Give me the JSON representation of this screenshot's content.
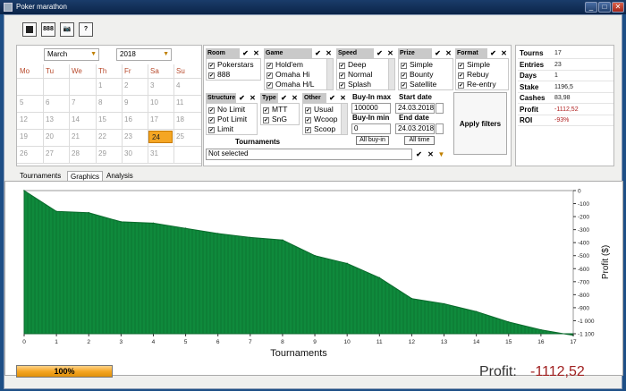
{
  "window": {
    "title": "Poker marathon"
  },
  "toolbar": {
    "buttons": [
      {
        "name": "open-button",
        "label": ""
      },
      {
        "name": "888-button",
        "label": "888"
      },
      {
        "name": "screenshot-button",
        "label": "📷"
      },
      {
        "name": "help-button",
        "label": "?"
      }
    ]
  },
  "calendar": {
    "month": "March",
    "year": "2018",
    "weekdays": [
      "Mo",
      "Tu",
      "We",
      "Th",
      "Fr",
      "Sa",
      "Su"
    ],
    "weeks": [
      [
        "",
        "",
        "",
        "1",
        "2",
        "3",
        "4"
      ],
      [
        "5",
        "6",
        "7",
        "8",
        "9",
        "10",
        "11"
      ],
      [
        "12",
        "13",
        "14",
        "15",
        "16",
        "17",
        "18"
      ],
      [
        "19",
        "20",
        "21",
        "22",
        "23",
        "24",
        "25"
      ],
      [
        "26",
        "27",
        "28",
        "29",
        "30",
        "31",
        ""
      ]
    ],
    "selected": "24"
  },
  "filters": {
    "room": {
      "title": "Room",
      "items": [
        "Pokerstars",
        "888"
      ]
    },
    "game": {
      "title": "Game",
      "items": [
        "Hold'em",
        "Omaha Hi",
        "Omaha H/L"
      ]
    },
    "speed": {
      "title": "Speed",
      "items": [
        "Deep",
        "Normal",
        "Splash"
      ]
    },
    "prize": {
      "title": "Prize",
      "items": [
        "Simple",
        "Bounty",
        "Satellite"
      ]
    },
    "format": {
      "title": "Format",
      "items": [
        "Simple",
        "Rebuy",
        "Re-entry"
      ]
    },
    "structure": {
      "title": "Structure",
      "items": [
        "No Limit",
        "Pot Limit",
        "Limit"
      ]
    },
    "type": {
      "title": "Type",
      "items": [
        "MTT",
        "SnG"
      ]
    },
    "other": {
      "title": "Other",
      "items": [
        "Usual",
        "Wcoop",
        "Scoop"
      ]
    },
    "buyin_max_label": "Buy-In max",
    "buyin_max": "100000",
    "buyin_min_label": "Buy-In min",
    "buyin_min": "0",
    "all_buyin": "All buy-in",
    "start_date_label": "Start date",
    "start_date": "24.03.2018",
    "end_date_label": "End date",
    "end_date": "24.03.2018",
    "all_time": "All time",
    "apply": "Apply filters",
    "tournaments_label": "Tournaments",
    "tournaments_value": "Not selected"
  },
  "stats": [
    {
      "k": "Tourns",
      "v": "17",
      "color": "#222222"
    },
    {
      "k": "Entries",
      "v": "23",
      "color": "#222222"
    },
    {
      "k": "Days",
      "v": "1",
      "color": "#222222"
    },
    {
      "k": "Stake",
      "v": "1196,5",
      "color": "#222222"
    },
    {
      "k": "Cashes",
      "v": "83,98",
      "color": "#222222"
    },
    {
      "k": "Profit",
      "v": "-1112,52",
      "color": "#b02020"
    },
    {
      "k": "ROI",
      "v": "-93%",
      "color": "#b02020"
    }
  ],
  "tabs": [
    "Tournaments",
    "Graphics",
    "Analysis"
  ],
  "active_tab": "Graphics",
  "chart_data": {
    "type": "area",
    "xlabel": "Tournaments",
    "ylabel": "Profit ($)",
    "x": [
      0,
      1,
      2,
      3,
      4,
      5,
      6,
      7,
      8,
      9,
      10,
      11,
      12,
      13,
      14,
      15,
      16,
      17
    ],
    "values": [
      0,
      -160,
      -170,
      -240,
      -250,
      -290,
      -330,
      -360,
      -380,
      -500,
      -560,
      -670,
      -830,
      -870,
      -930,
      -1010,
      -1070,
      -1112.52
    ],
    "xlim": [
      0,
      17
    ],
    "ylim": [
      -1100,
      0
    ],
    "xticks": [
      "0",
      "1",
      "2",
      "3",
      "4",
      "5",
      "6",
      "7",
      "8",
      "9",
      "10",
      "11",
      "12",
      "13",
      "14",
      "15",
      "16",
      "17"
    ],
    "yticks": [
      "0",
      "-100",
      "-200",
      "-300",
      "-400",
      "-500",
      "-600",
      "-700",
      "-800",
      "-900",
      "-1 000",
      "-1 100"
    ],
    "color": "#0f8a3c",
    "grid": true
  },
  "progress": {
    "label": "100%",
    "value": 1.0
  },
  "footer": {
    "profit_label": "Profit:",
    "profit_value": "-1112,52"
  }
}
